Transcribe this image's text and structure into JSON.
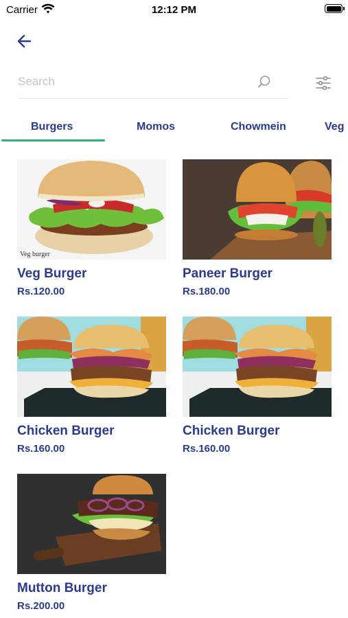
{
  "status_bar": {
    "carrier": "Carrier",
    "time": "12:12 PM"
  },
  "search": {
    "placeholder": "Search",
    "value": ""
  },
  "tabs": [
    {
      "label": "Burgers",
      "active": true
    },
    {
      "label": "Momos",
      "active": false
    },
    {
      "label": "Chowmein",
      "active": false
    },
    {
      "label": "Veg",
      "active": false
    }
  ],
  "products": [
    {
      "name": "Veg Burger",
      "price": "Rs.120.00",
      "image_caption": "Veg burger"
    },
    {
      "name": "Paneer Burger",
      "price": "Rs.180.00"
    },
    {
      "name": "Chicken Burger",
      "price": "Rs.160.00"
    },
    {
      "name": "Chicken Burger",
      "price": "Rs.160.00"
    },
    {
      "name": "Mutton Burger",
      "price": "Rs.200.00"
    }
  ],
  "colors": {
    "accent": "#2b3a8c",
    "tab_indicator": "#2fb36d"
  }
}
